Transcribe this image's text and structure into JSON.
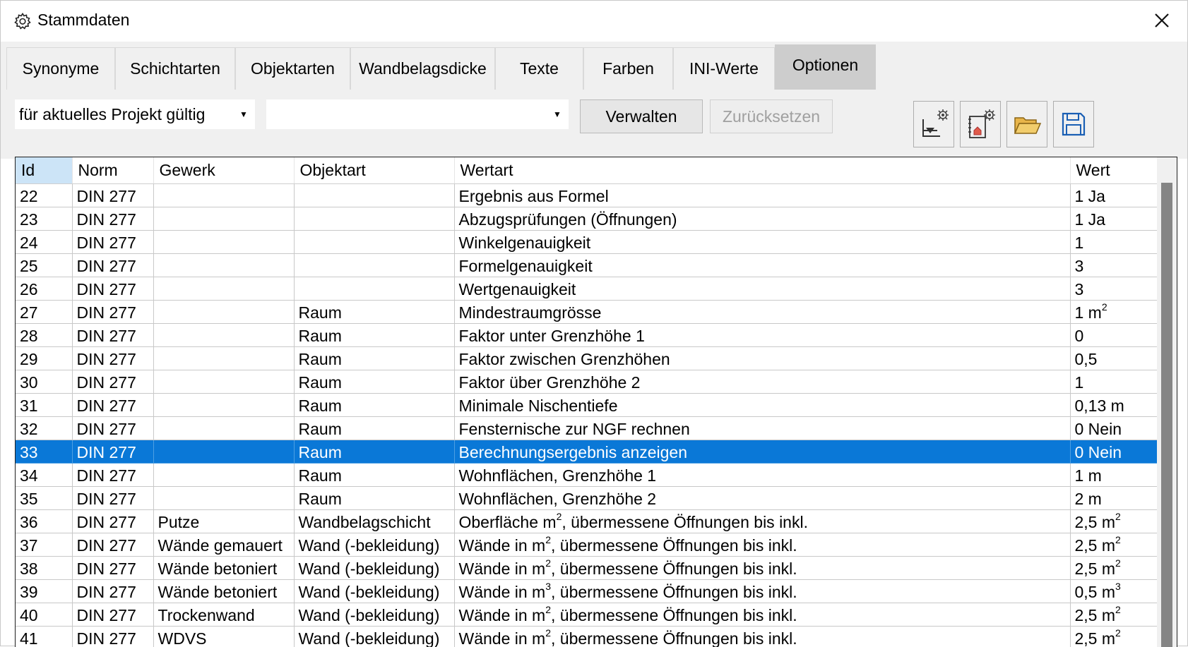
{
  "window": {
    "title": "Stammdaten"
  },
  "tabs": [
    {
      "label": "Synonyme",
      "active": false
    },
    {
      "label": "Schichtarten",
      "active": false
    },
    {
      "label": "Objektarten",
      "active": false
    },
    {
      "label": "Wandbelagsdicke",
      "active": false
    },
    {
      "label": "Texte",
      "active": false
    },
    {
      "label": "Farben",
      "active": false
    },
    {
      "label": "INI-Werte",
      "active": false
    },
    {
      "label": "Optionen",
      "active": true
    }
  ],
  "toolbar": {
    "scope_select": "für aktuelles Projekt gültig",
    "second_select": "",
    "manage_label": "Verwalten",
    "reset_label": "Zurücksetzen",
    "icon_buttons": [
      "chart-settings-icon",
      "building-settings-icon",
      "folder-open-icon",
      "save-icon"
    ]
  },
  "grid": {
    "columns": [
      "Id",
      "Norm",
      "Gewerk",
      "Objektart",
      "Wertart",
      "Wert"
    ],
    "selected_id": "33",
    "rows": [
      {
        "id": "22",
        "norm": "DIN 277",
        "gewerk": "",
        "objektart": "",
        "wertart": "Ergebnis aus Formel",
        "wert": "1 Ja"
      },
      {
        "id": "23",
        "norm": "DIN 277",
        "gewerk": "",
        "objektart": "",
        "wertart": "Abzugsprüfungen (Öffnungen)",
        "wert": "1 Ja"
      },
      {
        "id": "24",
        "norm": "DIN 277",
        "gewerk": "",
        "objektart": "",
        "wertart": "Winkelgenauigkeit",
        "wert": "1"
      },
      {
        "id": "25",
        "norm": "DIN 277",
        "gewerk": "",
        "objektart": "",
        "wertart": "Formelgenauigkeit",
        "wert": "3"
      },
      {
        "id": "26",
        "norm": "DIN 277",
        "gewerk": "",
        "objektart": "",
        "wertart": "Wertgenauigkeit",
        "wert": "3"
      },
      {
        "id": "27",
        "norm": "DIN 277",
        "gewerk": "",
        "objektart": "Raum",
        "wertart": "Mindestraumgrösse",
        "wert": "1 m²"
      },
      {
        "id": "28",
        "norm": "DIN 277",
        "gewerk": "",
        "objektart": "Raum",
        "wertart": "Faktor unter Grenzhöhe 1",
        "wert": "0"
      },
      {
        "id": "29",
        "norm": "DIN 277",
        "gewerk": "",
        "objektart": "Raum",
        "wertart": "Faktor zwischen Grenzhöhen",
        "wert": "0,5"
      },
      {
        "id": "30",
        "norm": "DIN 277",
        "gewerk": "",
        "objektart": "Raum",
        "wertart": "Faktor über Grenzhöhe 2",
        "wert": "1"
      },
      {
        "id": "31",
        "norm": "DIN 277",
        "gewerk": "",
        "objektart": "Raum",
        "wertart": "Minimale Nischentiefe",
        "wert": "0,13 m"
      },
      {
        "id": "32",
        "norm": "DIN 277",
        "gewerk": "",
        "objektart": "Raum",
        "wertart": "Fensternische zur NGF rechnen",
        "wert": "0 Nein"
      },
      {
        "id": "33",
        "norm": "DIN 277",
        "gewerk": "",
        "objektart": "Raum",
        "wertart": "Berechnungsergebnis anzeigen",
        "wert": "0 Nein"
      },
      {
        "id": "34",
        "norm": "DIN 277",
        "gewerk": "",
        "objektart": "Raum",
        "wertart": "Wohnflächen, Grenzhöhe 1",
        "wert": "1 m"
      },
      {
        "id": "35",
        "norm": "DIN 277",
        "gewerk": "",
        "objektart": "Raum",
        "wertart": "Wohnflächen, Grenzhöhe 2",
        "wert": "2 m"
      },
      {
        "id": "36",
        "norm": "DIN 277",
        "gewerk": "Putze",
        "objektart": "Wandbelagschicht",
        "wertart": "Oberfläche m², übermessene Öffnungen bis inkl.",
        "wert": "2,5 m²"
      },
      {
        "id": "37",
        "norm": "DIN 277",
        "gewerk": "Wände gemauert",
        "objektart": "Wand (-bekleidung)",
        "wertart": "Wände in m², übermessene Öffnungen bis inkl.",
        "wert": "2,5 m²"
      },
      {
        "id": "38",
        "norm": "DIN 277",
        "gewerk": "Wände betoniert",
        "objektart": "Wand (-bekleidung)",
        "wertart": "Wände in m², übermessene Öffnungen bis inkl.",
        "wert": "2,5 m²"
      },
      {
        "id": "39",
        "norm": "DIN 277",
        "gewerk": "Wände betoniert",
        "objektart": "Wand (-bekleidung)",
        "wertart": "Wände in m³, übermessene Öffnungen bis inkl.",
        "wert": "0,5 m³"
      },
      {
        "id": "40",
        "norm": "DIN 277",
        "gewerk": "Trockenwand",
        "objektart": "Wand (-bekleidung)",
        "wertart": "Wände in m², übermessene Öffnungen bis inkl.",
        "wert": "2,5 m²"
      },
      {
        "id": "41",
        "norm": "DIN 277",
        "gewerk": "WDVS",
        "objektart": "Wand (-bekleidung)",
        "wertart": "Wände in m², übermessene Öffnungen bis inkl.",
        "wert": "2,5 m²"
      }
    ]
  },
  "colors": {
    "selection": "#0a78d7",
    "active_tab": "#cdcdcd",
    "header_selected": "#cce4f7"
  }
}
